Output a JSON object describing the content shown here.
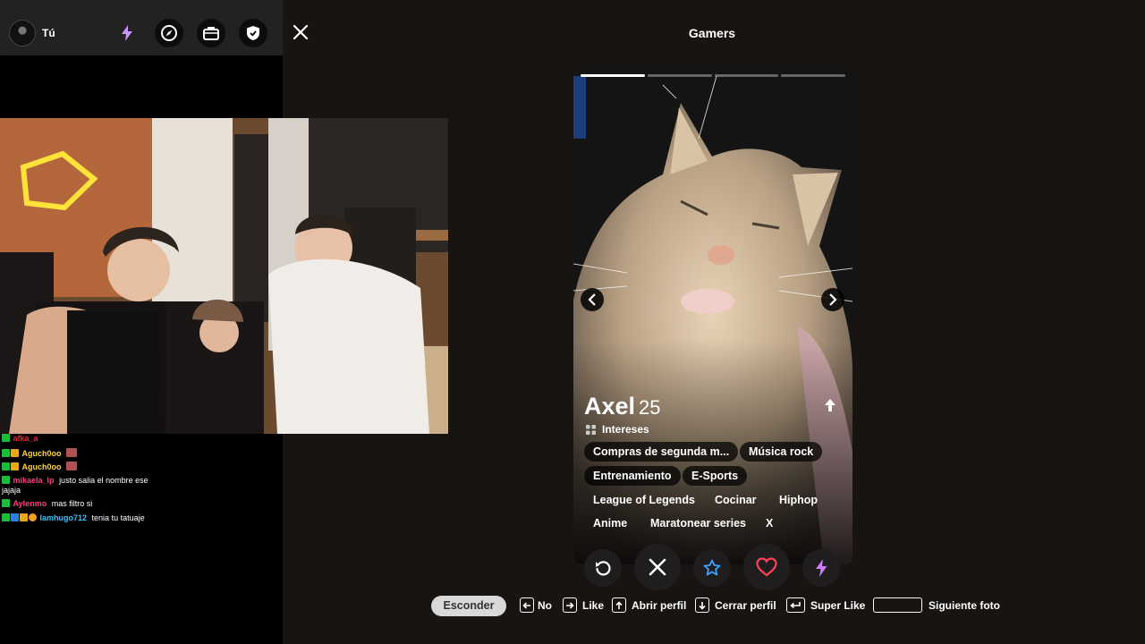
{
  "topbar": {
    "user_name": "Tú",
    "icons": [
      "lightning-icon",
      "compass-icon",
      "briefcase-icon",
      "shield-icon"
    ]
  },
  "header": {
    "title": "Gamers"
  },
  "chat": {
    "messages": [
      {
        "user": "afka_a",
        "text": "",
        "user_color": "#e0283a"
      },
      {
        "user": "Aguch0oo",
        "text": "",
        "user_color": "#ffd23c"
      },
      {
        "user": "Aguch0oo",
        "text": "",
        "user_color": "#ffd23c"
      },
      {
        "user": "mikaela_lp",
        "text": "justo salia el nombre ese",
        "user_color": "#ff3d7f"
      },
      {
        "user": "",
        "text": "jajaja",
        "user_color": "#ffffff"
      },
      {
        "user": "Aylenmo",
        "text": "mas filtro si",
        "user_color": "#ff3d7f"
      },
      {
        "user": "lamhugo712",
        "text": "tenia tu tatuaje",
        "user_color": "#39c0ff"
      }
    ]
  },
  "card": {
    "name": "Axel",
    "age": "25",
    "photo_count": 4,
    "active_photo": 1,
    "interests_label": "Intereses",
    "tags": [
      "Compras de segunda m...",
      "Música rock",
      "Entrenamiento",
      "E-Sports",
      "League of Legends",
      "Cocinar",
      "Hiphop",
      "Anime",
      "Maratonear series",
      "X"
    ]
  },
  "actions": [
    "rewind-icon",
    "nope-icon",
    "super-like-star-icon",
    "like-heart-icon",
    "boost-lightning-icon"
  ],
  "hints": {
    "hide_label": "Esconder",
    "no": "No",
    "like": "Like",
    "open_profile": "Abrir perfil",
    "close_profile": "Cerrar perfil",
    "super_like": "Super Like",
    "next_photo": "Siguiente foto"
  },
  "colors": {
    "like": "#ff4458",
    "super_like": "#3ca4ff",
    "boost": "#ce7cff",
    "rewind": "#ffffff",
    "background": "#171412"
  }
}
